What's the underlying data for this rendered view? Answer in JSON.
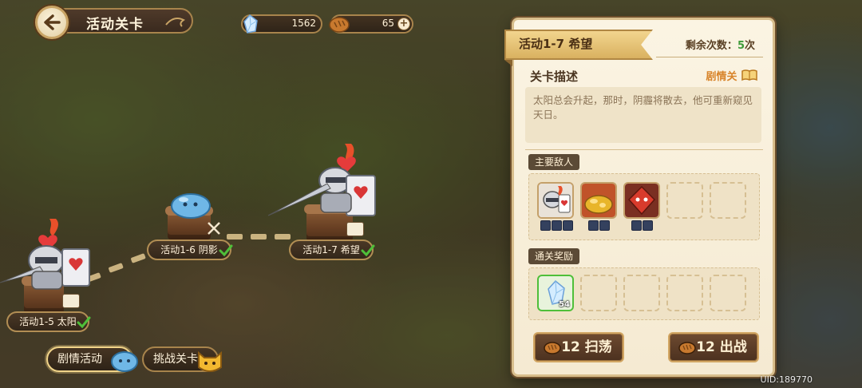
{
  "header": {
    "title": "活动关卡"
  },
  "currency": {
    "gems": "1562",
    "bread": "65",
    "plus_label": "+"
  },
  "stages": [
    {
      "label": "活动1-5 太阳",
      "cleared": true,
      "type": "story"
    },
    {
      "label": "活动1-6 阴影",
      "cleared": true,
      "type": "battle"
    },
    {
      "label": "活动1-7 希望",
      "cleared": true,
      "type": "story"
    }
  ],
  "tabs": {
    "story": "剧情活动",
    "challenge": "挑战关卡"
  },
  "panel": {
    "stage_title": "活动1-7  希望",
    "remaining_label": "剩余次数：",
    "remaining_count": "5",
    "remaining_unit": "次",
    "desc_title": "关卡描述",
    "story_tag": "剧情关",
    "description": "太阳总会升起，那时，阴霾将散去，他可重新窥见天日。",
    "enemies_label": "主要敌人",
    "enemies": [
      {
        "name": "heart-knight",
        "color": "#c23a3a"
      },
      {
        "name": "gold-treasure",
        "color": "#d99a1e"
      },
      {
        "name": "red-card-soldier",
        "color": "#c0392b"
      }
    ],
    "rewards_label": "通关奖励",
    "rewards": [
      {
        "name": "crystal",
        "qty": "54"
      }
    ],
    "sweep_button": "12 扫荡",
    "battle_button": "12 出战"
  },
  "footer": {
    "uid": "UID:189770"
  },
  "colors": {
    "accent_gold": "#d8be8c",
    "check_green": "#4fbf3a",
    "panel_bg": "#fbf4e3",
    "button_brown": "#6e4a30"
  }
}
